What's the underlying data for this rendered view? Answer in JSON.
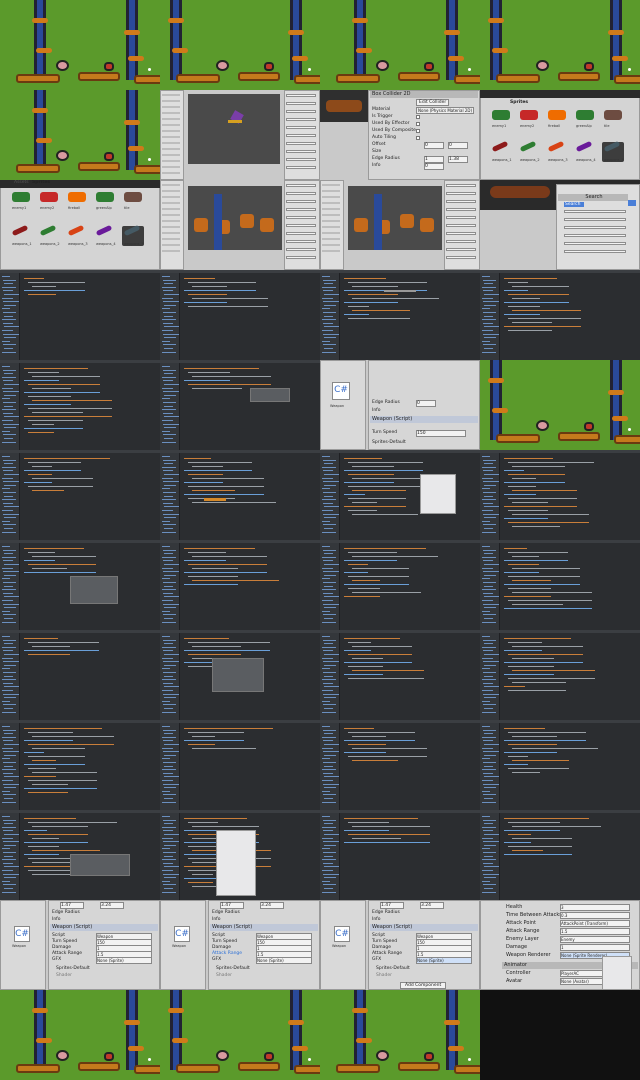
{
  "grid": {
    "tiles": [
      {
        "type": "game"
      },
      {
        "type": "game"
      },
      {
        "type": "game"
      },
      {
        "type": "game"
      },
      {
        "type": "game"
      },
      {
        "type": "unity-scene"
      },
      {
        "type": "unity-inspector-box"
      },
      {
        "type": "unity-sprites"
      },
      {
        "type": "unity-sprites-assets"
      },
      {
        "type": "unity-scene-boxes"
      },
      {
        "type": "unity-scene-boxes"
      },
      {
        "type": "unity-search"
      },
      {
        "type": "code"
      },
      {
        "type": "code"
      },
      {
        "type": "code"
      },
      {
        "type": "code"
      },
      {
        "type": "code"
      },
      {
        "type": "code"
      },
      {
        "type": "unity-inspector-weapon"
      },
      {
        "type": "game"
      },
      {
        "type": "code"
      },
      {
        "type": "code"
      },
      {
        "type": "code"
      },
      {
        "type": "code"
      },
      {
        "type": "code"
      },
      {
        "type": "code"
      },
      {
        "type": "code"
      },
      {
        "type": "code"
      },
      {
        "type": "code"
      },
      {
        "type": "code"
      },
      {
        "type": "code"
      },
      {
        "type": "code"
      },
      {
        "type": "code"
      },
      {
        "type": "code"
      },
      {
        "type": "code"
      },
      {
        "type": "code"
      },
      {
        "type": "code"
      },
      {
        "type": "code"
      },
      {
        "type": "code"
      },
      {
        "type": "code"
      },
      {
        "type": "unity-weapon-script"
      },
      {
        "type": "unity-weapon-script"
      },
      {
        "type": "unity-weapon-script"
      },
      {
        "type": "unity-player-inspector"
      },
      {
        "type": "game"
      },
      {
        "type": "game"
      },
      {
        "type": "game"
      },
      {
        "type": "black"
      }
    ]
  },
  "box_collider": {
    "title": "Box Collider 2D",
    "edit_label": "Edit Collider",
    "material_label": "Material",
    "material_value": "None (Physics Material 2D)",
    "rows": [
      "Is Trigger",
      "Used By Effector",
      "Used By Composite",
      "Auto Tiling",
      "Offset",
      "Size",
      "Edge Radius",
      "Info"
    ],
    "offset": [
      "0",
      "0"
    ],
    "size": [
      "1",
      "1.38"
    ],
    "edge_radius": "0"
  },
  "sprites": {
    "breadcrumb_assets": "Assets",
    "breadcrumb_sprites": "Sprites",
    "items": [
      "enemy1",
      "enemy2",
      "fireball",
      "greenAlp",
      "tile"
    ],
    "weapons": [
      "weapons_1",
      "weapons_2",
      "weapons_3",
      "weapons_4",
      "weapons_5"
    ],
    "sprite_colors": [
      "#2e7d32",
      "#c62828",
      "#ef6c00",
      "#2e7d32",
      "#6d4c41"
    ],
    "weapon_colors": [
      "#8d1b1b",
      "#2e7d32",
      "#d84315",
      "#6a1b9a",
      "#455a64"
    ]
  },
  "search": {
    "title": "Search",
    "hint": "Search"
  },
  "weapon_inspector": {
    "script_header": "Weapon (Script)",
    "script_label": "Script",
    "script_value": "Weapon",
    "turn_speed_label": "Turn Speed",
    "turn_speed_value": "150",
    "damage_label": "Damage",
    "damage_value": "1",
    "attack_range_label": "Attack Range",
    "attack_range_value": "1.5",
    "gfx_label": "GFX",
    "gfx_value": "None (Sprite)",
    "sprites_default": "Sprites-Default",
    "shader_label": "Shader",
    "shader_value": "Sprites/Default",
    "add_component": "Add Component",
    "size_x": "1.47",
    "size_y": "3.24",
    "edge_radius_label": "Edge Radius",
    "edge_radius_value": "0",
    "info": "Info",
    "cs_icon": "C#",
    "asset_name": "Weapon"
  },
  "player_inspector": {
    "rows": [
      {
        "label": "Health",
        "value": "3"
      },
      {
        "label": "Time Between Attacks",
        "value": "0.3"
      },
      {
        "label": "Attack Point",
        "value": "AttackPoint (Transform)"
      },
      {
        "label": "Attack Range",
        "value": "1.5"
      },
      {
        "label": "Enemy Layer",
        "value": "Enemy"
      },
      {
        "label": "Damage",
        "value": "1"
      },
      {
        "label": "Weapon Renderer",
        "value": "None (Sprite Renderer)"
      }
    ],
    "animator_header": "Animator",
    "controller_label": "Controller",
    "controller_value": "PlayerAC",
    "avatar_label": "Avatar",
    "avatar_value": "None (Avatar)"
  }
}
